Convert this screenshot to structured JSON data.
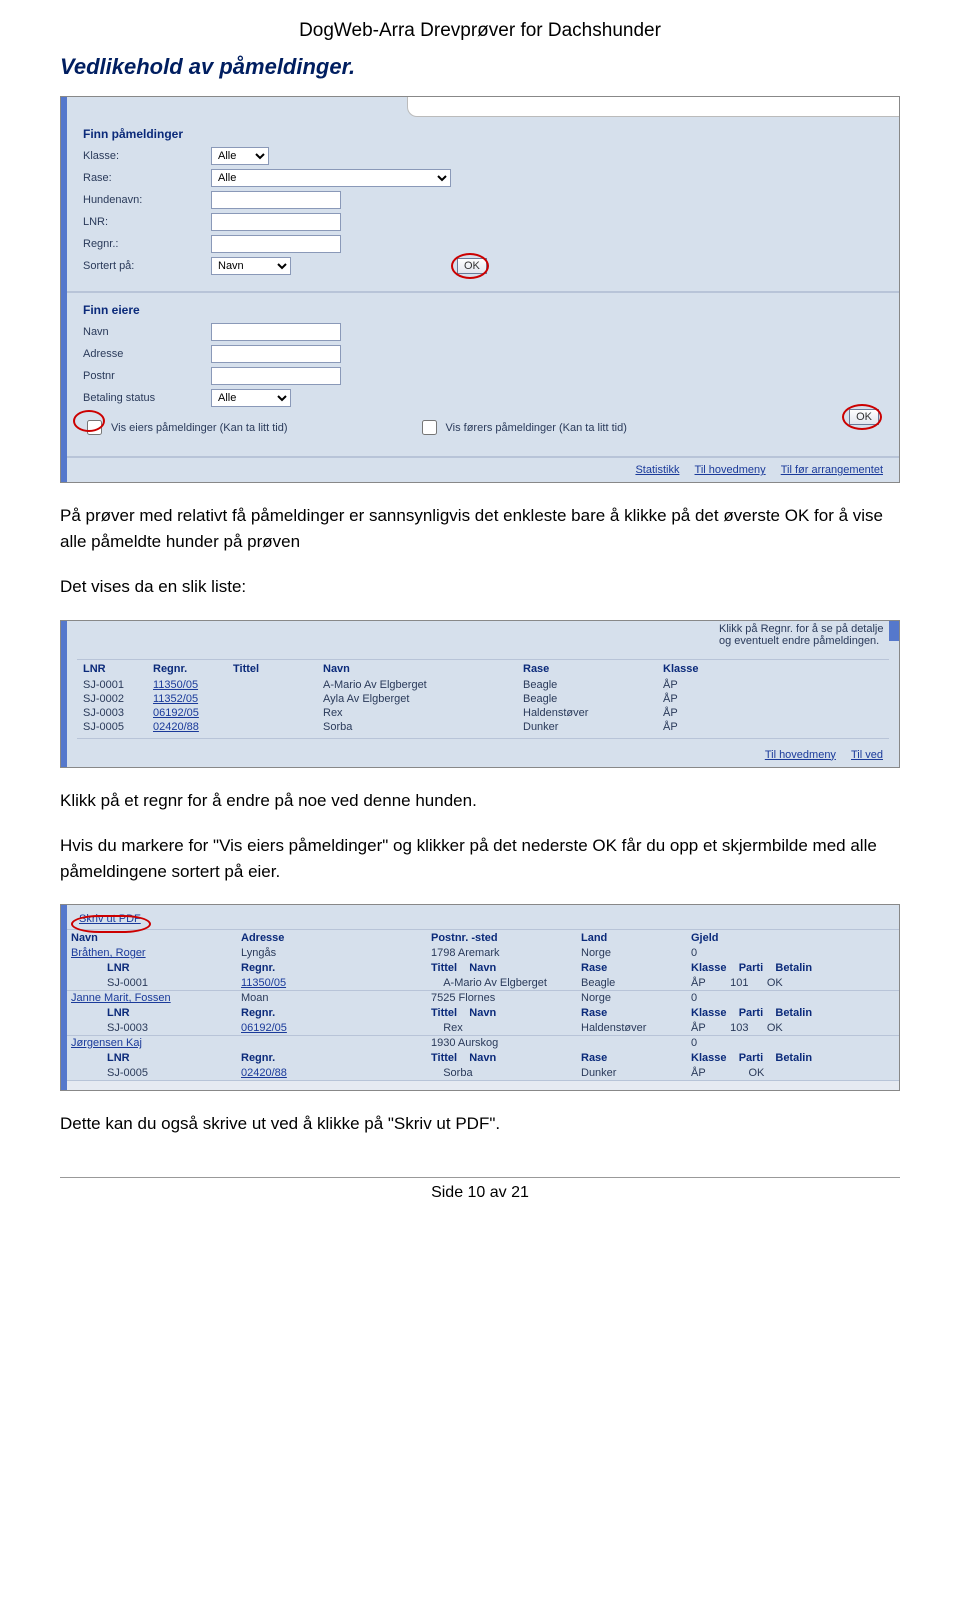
{
  "header": {
    "title": "DogWeb-Arra Drevprøver for Dachshunder"
  },
  "section1_title": "Vedlikehold av påmeldinger.",
  "para1": "På prøver med relativt få påmeldinger er sannsynligvis det enkleste bare å klikke på det øverste OK for å vise alle påmeldte hunder på prøven",
  "para2": "Det vises da en slik liste:",
  "para3": "Klikk på et regnr for å endre på noe ved denne hunden.",
  "para4": "Hvis du markere for \"Vis eiers påmeldinger\" og klikker på det nederste OK får du opp et skjermbilde med alle påmeldingene sortert på eier.",
  "para5": "Dette kan du også skrive ut ved å klikke på \"Skriv ut PDF\".",
  "footer": "Side 10 av 21",
  "form1": {
    "heading": "Finn påmeldinger",
    "klasse": "Klasse:",
    "klasse_val": "Alle",
    "rase": "Rase:",
    "rase_val": "Alle",
    "hundenavn": "Hundenavn:",
    "lnr": "LNR:",
    "regnr": "Regnr.:",
    "sortert": "Sortert på:",
    "sortert_val": "Navn",
    "ok": "OK"
  },
  "form2": {
    "heading": "Finn eiere",
    "navn": "Navn",
    "adresse": "Adresse",
    "postnr": "Postnr",
    "betaling": "Betaling status",
    "betaling_val": "Alle",
    "vis_eiers": "Vis eiers påmeldinger (Kan ta litt tid)",
    "vis_forers": "Vis førers påmeldinger (Kan ta litt tid)",
    "ok": "OK"
  },
  "links1": {
    "stat": "Statistikk",
    "hoved": "Til hovedmeny",
    "arr": "Til før arrangementet"
  },
  "notice": "og eventuelt endre påmeldingen.",
  "notice_top": "Klikk på Regnr. for å se på detalje",
  "tbl": {
    "headers": {
      "lnr": "LNR",
      "regnr": "Regnr.",
      "tittel": "Tittel",
      "navn": "Navn",
      "rase": "Rase",
      "klasse": "Klasse"
    },
    "rows": [
      {
        "lnr": "SJ-0001",
        "regnr": "11350/05",
        "tittel": "",
        "navn": "A-Mario Av Elgberget",
        "rase": "Beagle",
        "klasse": "ÅP"
      },
      {
        "lnr": "SJ-0002",
        "regnr": "11352/05",
        "tittel": "",
        "navn": "Ayla Av Elgberget",
        "rase": "Beagle",
        "klasse": "ÅP"
      },
      {
        "lnr": "SJ-0003",
        "regnr": "06192/05",
        "tittel": "",
        "navn": "Rex",
        "rase": "Haldenstøver",
        "klasse": "ÅP"
      },
      {
        "lnr": "SJ-0005",
        "regnr": "02420/88",
        "tittel": "",
        "navn": "Sorba",
        "rase": "Dunker",
        "klasse": "ÅP"
      }
    ]
  },
  "links2": {
    "hoved": "Til hovedmeny",
    "ved": "Til ved"
  },
  "pdf_link": "Skriv ut PDF",
  "owner_hdr": {
    "navn": "Navn",
    "adresse": "Adresse",
    "post": "Postnr. -sted",
    "land": "Land",
    "gjeld": "Gjeld"
  },
  "owner_sub": {
    "lnr": "LNR",
    "regnr": "Regnr.",
    "tittel": "Tittel",
    "navn": "Navn",
    "rase": "Rase",
    "klasse": "Klasse",
    "parti": "Parti",
    "betalin": "Betalin"
  },
  "owners": [
    {
      "navn": "Bråthen, Roger",
      "adresse": "Lyngås",
      "post": "1798  Aremark",
      "land": "Norge",
      "gjeld": "0",
      "dogs": [
        {
          "lnr": "SJ-0001",
          "regnr": "11350/05",
          "tittel": "",
          "navn": "A-Mario Av Elgberget",
          "rase": "Beagle",
          "klasse": "ÅP",
          "parti": "101",
          "betalin": "OK"
        }
      ]
    },
    {
      "navn": "Janne Marit, Fossen",
      "adresse": "Moan",
      "post": "7525  Flornes",
      "land": "Norge",
      "gjeld": "0",
      "dogs": [
        {
          "lnr": "SJ-0003",
          "regnr": "06192/05",
          "tittel": "",
          "navn": "Rex",
          "rase": "Haldenstøver",
          "klasse": "ÅP",
          "parti": "103",
          "betalin": "OK"
        }
      ]
    },
    {
      "navn": "Jørgensen Kaj",
      "adresse": "",
      "post": "1930  Aurskog",
      "land": "",
      "gjeld": "0",
      "dogs": [
        {
          "lnr": "SJ-0005",
          "regnr": "02420/88",
          "tittel": "",
          "navn": "Sorba",
          "rase": "Dunker",
          "klasse": "ÅP",
          "parti": "",
          "betalin": "OK"
        }
      ]
    }
  ]
}
